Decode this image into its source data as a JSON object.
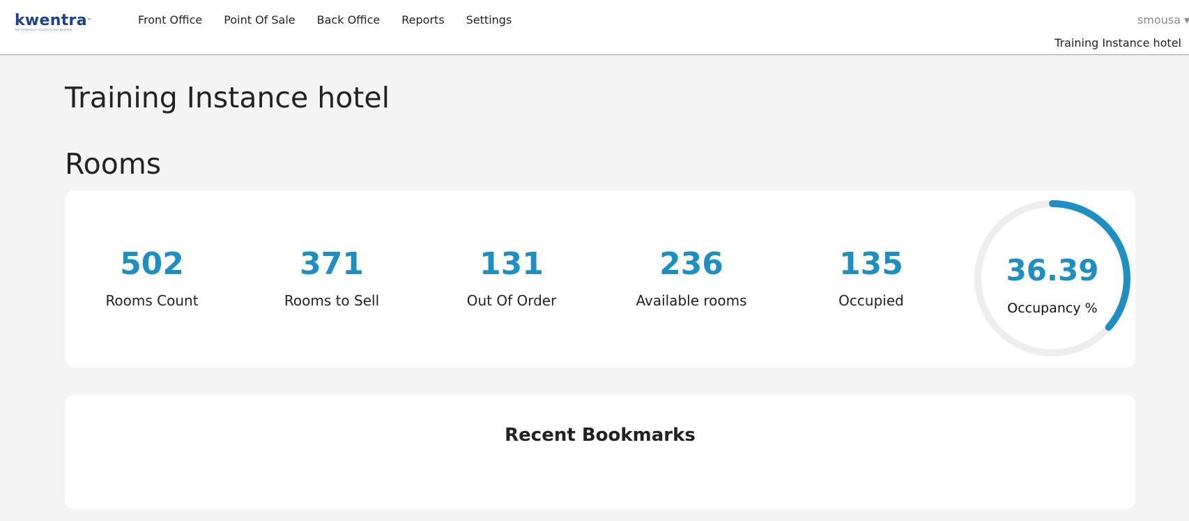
{
  "header": {
    "logo_text": "kwentra",
    "logo_tagline": "THE HOSPITALITY SOLUTION YOU DESERVE",
    "nav": [
      {
        "label": "Front Office"
      },
      {
        "label": "Point Of Sale"
      },
      {
        "label": "Back Office"
      },
      {
        "label": "Reports"
      },
      {
        "label": "Settings"
      }
    ],
    "user": "smousa",
    "hotel": "Training Instance hotel"
  },
  "page": {
    "title": "Training Instance hotel",
    "rooms_title": "Rooms"
  },
  "rooms": {
    "stats": [
      {
        "value": "502",
        "label": "Rooms Count"
      },
      {
        "value": "371",
        "label": "Rooms to Sell"
      },
      {
        "value": "131",
        "label": "Out Of Order"
      },
      {
        "value": "236",
        "label": "Available rooms"
      },
      {
        "value": "135",
        "label": "Occupied"
      }
    ],
    "occupancy": {
      "value": "36.39",
      "label": "Occupancy %",
      "percent": 36.39,
      "color": "#1e8fc2",
      "track_color": "#eeeeee"
    }
  },
  "bookmarks": {
    "title": "Recent Bookmarks"
  }
}
